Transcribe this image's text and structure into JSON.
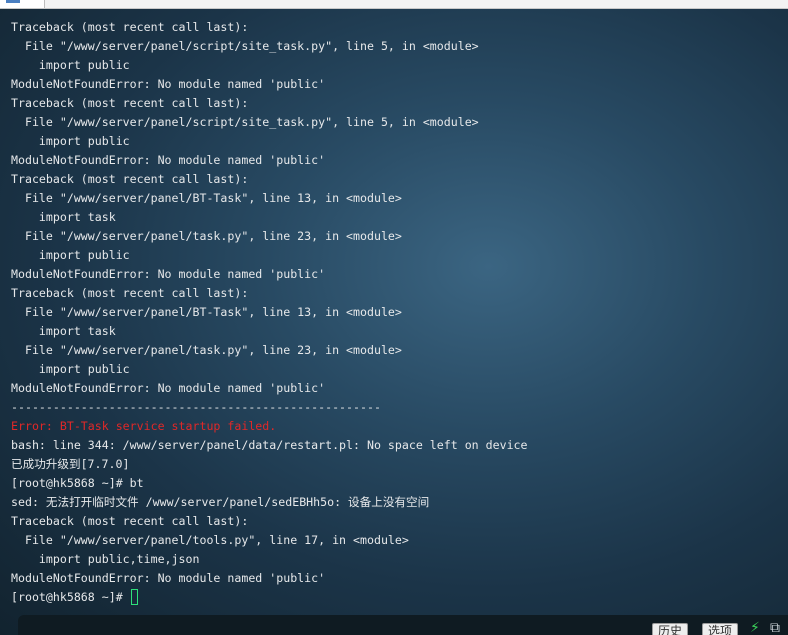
{
  "terminal": {
    "lines": [
      {
        "text": "Traceback (most recent call last):",
        "type": "normal"
      },
      {
        "text": "  File \"/www/server/panel/script/site_task.py\", line 5, in <module>",
        "type": "normal"
      },
      {
        "text": "    import public",
        "type": "normal"
      },
      {
        "text": "ModuleNotFoundError: No module named 'public'",
        "type": "normal"
      },
      {
        "text": "Traceback (most recent call last):",
        "type": "normal"
      },
      {
        "text": "  File \"/www/server/panel/script/site_task.py\", line 5, in <module>",
        "type": "normal"
      },
      {
        "text": "    import public",
        "type": "normal"
      },
      {
        "text": "ModuleNotFoundError: No module named 'public'",
        "type": "normal"
      },
      {
        "text": "Traceback (most recent call last):",
        "type": "normal"
      },
      {
        "text": "  File \"/www/server/panel/BT-Task\", line 13, in <module>",
        "type": "normal"
      },
      {
        "text": "    import task",
        "type": "normal"
      },
      {
        "text": "  File \"/www/server/panel/task.py\", line 23, in <module>",
        "type": "normal"
      },
      {
        "text": "    import public",
        "type": "normal"
      },
      {
        "text": "ModuleNotFoundError: No module named 'public'",
        "type": "normal"
      },
      {
        "text": "Traceback (most recent call last):",
        "type": "normal"
      },
      {
        "text": "  File \"/www/server/panel/BT-Task\", line 13, in <module>",
        "type": "normal"
      },
      {
        "text": "    import task",
        "type": "normal"
      },
      {
        "text": "  File \"/www/server/panel/task.py\", line 23, in <module>",
        "type": "normal"
      },
      {
        "text": "    import public",
        "type": "normal"
      },
      {
        "text": "ModuleNotFoundError: No module named 'public'",
        "type": "normal"
      },
      {
        "text": "-----------------------------------------------------",
        "type": "normal"
      },
      {
        "text": "Error: BT-Task service startup failed.",
        "type": "error"
      },
      {
        "text": "bash: line 344: /www/server/panel/data/restart.pl: No space left on device",
        "type": "normal"
      },
      {
        "text": "已成功升级到[7.7.0]",
        "type": "normal"
      },
      {
        "text": "[root@hk5868 ~]# bt",
        "type": "normal"
      },
      {
        "text": "sed: 无法打开临时文件 /www/server/panel/sedEBHh5o: 设备上没有空间",
        "type": "normal"
      },
      {
        "text": "Traceback (most recent call last):",
        "type": "normal"
      },
      {
        "text": "  File \"/www/server/panel/tools.py\", line 17, in <module>",
        "type": "normal"
      },
      {
        "text": "    import public,time,json",
        "type": "normal"
      },
      {
        "text": "ModuleNotFoundError: No module named 'public'",
        "type": "normal"
      }
    ],
    "prompt": "[root@hk5868 ~]# "
  },
  "bottom_bar": {
    "history_label": "历史",
    "options_label": "选项",
    "bolt_icon": "lightning-icon",
    "copy_icon": "copy-icon"
  },
  "colors": {
    "text": "#e6e8ea",
    "error": "#e02828",
    "cursor": "#2ee07a",
    "bolt": "#3cd35a"
  }
}
